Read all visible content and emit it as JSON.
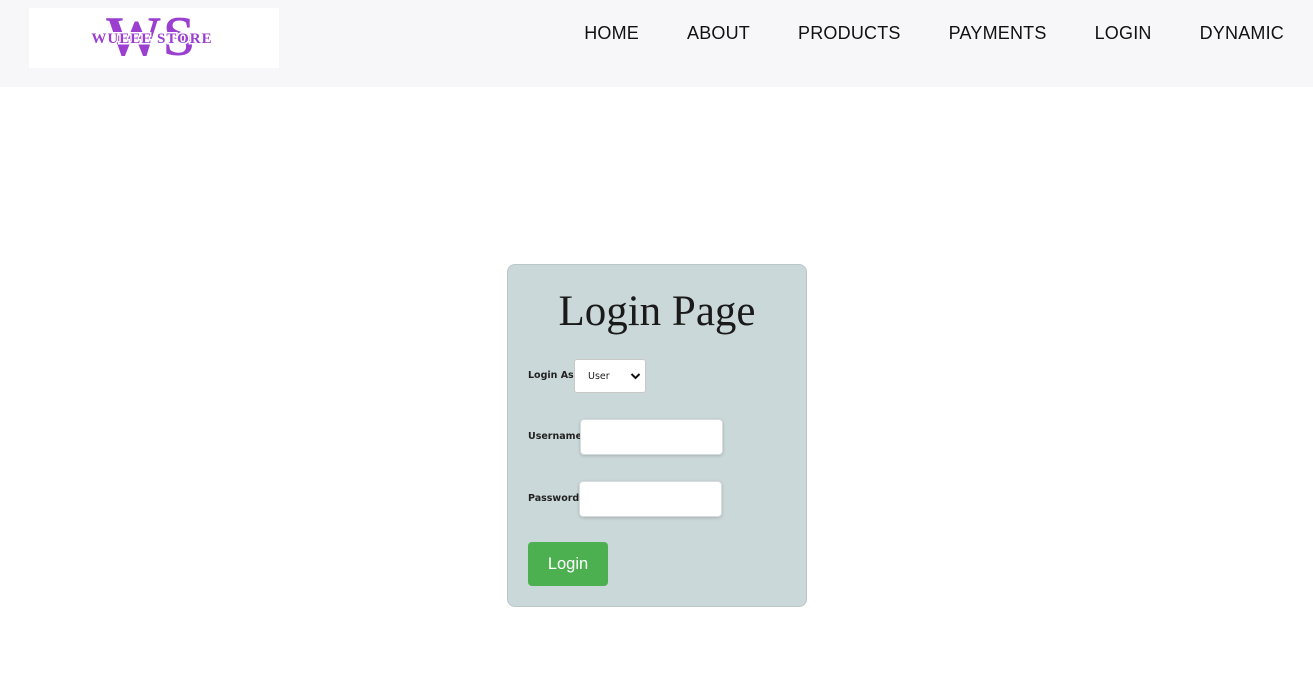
{
  "header": {
    "logo": {
      "monogram": "WS",
      "name": "WUEEE STORE"
    },
    "nav": [
      {
        "label": "HOME"
      },
      {
        "label": "ABOUT"
      },
      {
        "label": "PRODUCTS"
      },
      {
        "label": "PAYMENTS"
      },
      {
        "label": "LOGIN"
      },
      {
        "label": "DYNAMIC"
      }
    ]
  },
  "login": {
    "title": "Login Page",
    "login_as_label": "Login As:",
    "login_as_value": "User",
    "username_label": "Username:",
    "username_value": "",
    "password_label": "Password:",
    "password_value": "",
    "button_label": "Login"
  },
  "colors": {
    "nav_bg": "#f7f7f9",
    "card_bg": "#cbd8d9",
    "logo_purple": "#9b3fd1",
    "button_green": "#4caf50"
  }
}
